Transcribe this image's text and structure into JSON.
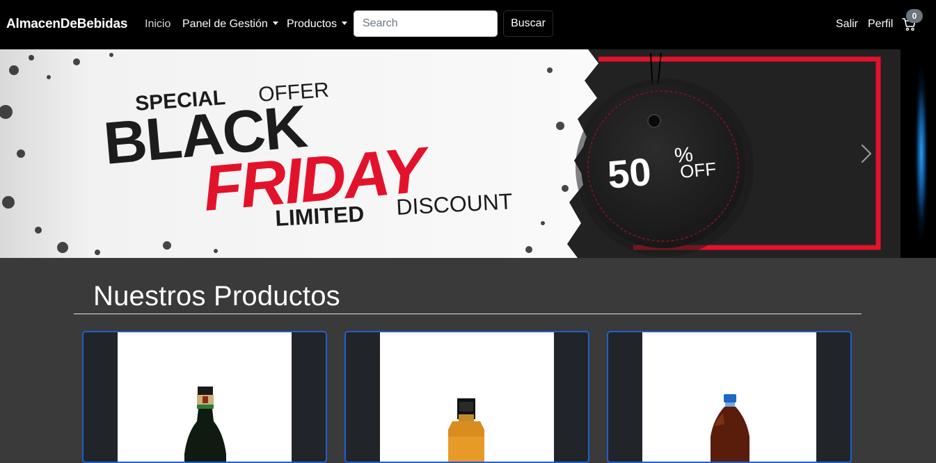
{
  "navbar": {
    "brand": "AlmacenDeBebidas",
    "links": {
      "inicio": "Inicio",
      "panel": "Panel de Gestión",
      "productos": "Productos",
      "salir": "Salir",
      "perfil": "Perfil"
    },
    "search": {
      "placeholder": "Search",
      "button": "Buscar"
    },
    "cart_count": "0"
  },
  "carousel": {
    "slide_text": {
      "special": "SPECIAL",
      "offer": "OFFER",
      "black": "BLACK",
      "friday": "FRIDAY",
      "limited": "LIMITED",
      "discount": "DISCOUNT",
      "percent_value": "50",
      "percent_sign": "%",
      "off": "OFF"
    }
  },
  "main": {
    "heading": "Nuestros Productos"
  },
  "colors": {
    "navbar_bg": "#000000",
    "page_bg": "#3a3a3a",
    "card_border": "#1f5fcf",
    "accent_red": "#e3122b"
  },
  "icons": {
    "cart": "cart-icon",
    "next": "chevron-right-icon",
    "caret": "caret-down-icon"
  }
}
